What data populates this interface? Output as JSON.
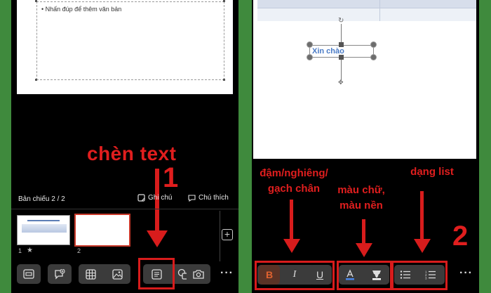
{
  "left_panel": {
    "slide_placeholder_text": "• Nhấn đúp để thêm văn bản",
    "annotation_label": "chèn text",
    "step_number": "1",
    "slide_counter": "Bản chiếu 2 / 2",
    "note_label": "Ghi chú",
    "comment_label": "Chú thích",
    "thumbnails": [
      {
        "number": "1",
        "marker": "★"
      },
      {
        "number": "2",
        "marker": ""
      }
    ],
    "add_slide_symbol": "+",
    "toolbar_icons": [
      "layout-icon",
      "add-comment-icon",
      "table-icon",
      "image-icon",
      "textbox-icon",
      "shapes-icon",
      "camera-icon"
    ],
    "more_symbol": "···"
  },
  "right_panel": {
    "textbox_text": "Xin chào",
    "format_label_line1": "đậm/nghiêng/",
    "format_label_line2": "gạch chân",
    "color_label_line1": "màu chữ,",
    "color_label_line2": "màu nền",
    "list_label": "dạng list",
    "step_number": "2",
    "format_buttons": {
      "bold": "B",
      "italic": "I",
      "underline": "U"
    },
    "toolbar_icons": [
      "text-color-icon",
      "highlight-icon",
      "bullet-list-icon",
      "numbered-list-icon"
    ],
    "more_symbol": "···"
  },
  "colors": {
    "annotation_red": "#d81c1c",
    "background_green": "#3f8a3d",
    "bold_active": "#e0622f"
  }
}
